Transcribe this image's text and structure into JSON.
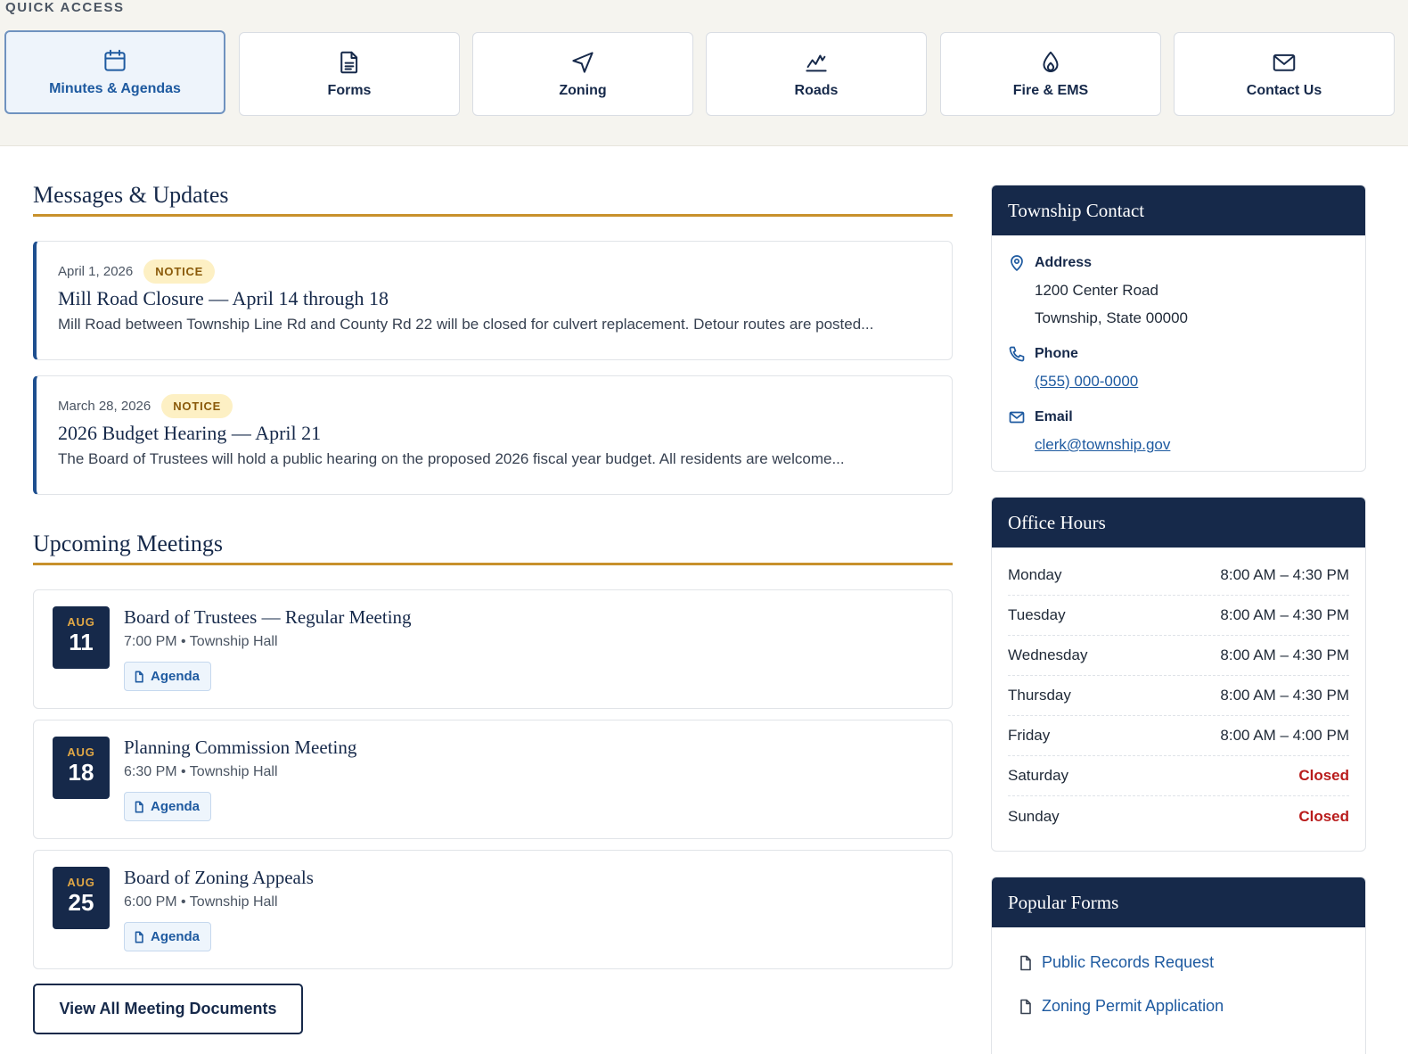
{
  "quick_access": {
    "title": "QUICK ACCESS",
    "tiles": [
      {
        "label": "Minutes & Agendas",
        "icon": "calendar-icon",
        "active": true
      },
      {
        "label": "Forms",
        "icon": "document-icon"
      },
      {
        "label": "Zoning",
        "icon": "navigation-icon"
      },
      {
        "label": "Roads",
        "icon": "chart-line-icon"
      },
      {
        "label": "Fire & EMS",
        "icon": "flame-icon"
      },
      {
        "label": "Contact Us",
        "icon": "mail-icon"
      }
    ]
  },
  "messages": {
    "heading": "Messages & Updates",
    "items": [
      {
        "date": "April 1, 2026",
        "badge": "NOTICE",
        "title": "Mill Road Closure — April 14 through 18",
        "body": "Mill Road between Township Line Rd and County Rd 22 will be closed for culvert replacement. Detour routes are posted..."
      },
      {
        "date": "March 28, 2026",
        "badge": "NOTICE",
        "title": "2026 Budget Hearing — April 21",
        "body": "The Board of Trustees will hold a public hearing on the proposed 2026 fiscal year budget. All residents are welcome..."
      }
    ]
  },
  "meetings": {
    "heading": "Upcoming Meetings",
    "items": [
      {
        "month": "AUG",
        "day": "11",
        "title": "Board of Trustees — Regular Meeting",
        "meta": "7:00 PM • Township Hall",
        "agenda_label": "Agenda"
      },
      {
        "month": "AUG",
        "day": "18",
        "title": "Planning Commission Meeting",
        "meta": "6:30 PM • Township Hall",
        "agenda_label": "Agenda"
      },
      {
        "month": "AUG",
        "day": "25",
        "title": "Board of Zoning Appeals",
        "meta": "6:00 PM • Township Hall",
        "agenda_label": "Agenda"
      }
    ],
    "view_all_label": "View All Meeting Documents"
  },
  "contact": {
    "heading": "Township Contact",
    "address_label": "Address",
    "address_line1": "1200 Center Road",
    "address_line2": "Township, State 00000",
    "phone_label": "Phone",
    "phone": "(555) 000-0000",
    "email_label": "Email",
    "email": "clerk@township.gov"
  },
  "office_hours": {
    "heading": "Office Hours",
    "rows": [
      {
        "day": "Monday",
        "hours": "8:00 AM – 4:30 PM"
      },
      {
        "day": "Tuesday",
        "hours": "8:00 AM – 4:30 PM"
      },
      {
        "day": "Wednesday",
        "hours": "8:00 AM – 4:30 PM"
      },
      {
        "day": "Thursday",
        "hours": "8:00 AM – 4:30 PM"
      },
      {
        "day": "Friday",
        "hours": "8:00 AM – 4:00 PM"
      },
      {
        "day": "Saturday",
        "hours": "Closed"
      },
      {
        "day": "Sunday",
        "hours": "Closed"
      }
    ]
  },
  "popular_forms": {
    "heading": "Popular Forms",
    "items": [
      {
        "label": "Public Records Request"
      },
      {
        "label": "Zoning Permit Application"
      }
    ]
  },
  "colors": {
    "navy": "#16294a",
    "link_blue": "#1e5aa0",
    "gold_rule": "#c8912c",
    "closed_red": "#b91c1c",
    "badge_bg": "#fdf0c4"
  }
}
